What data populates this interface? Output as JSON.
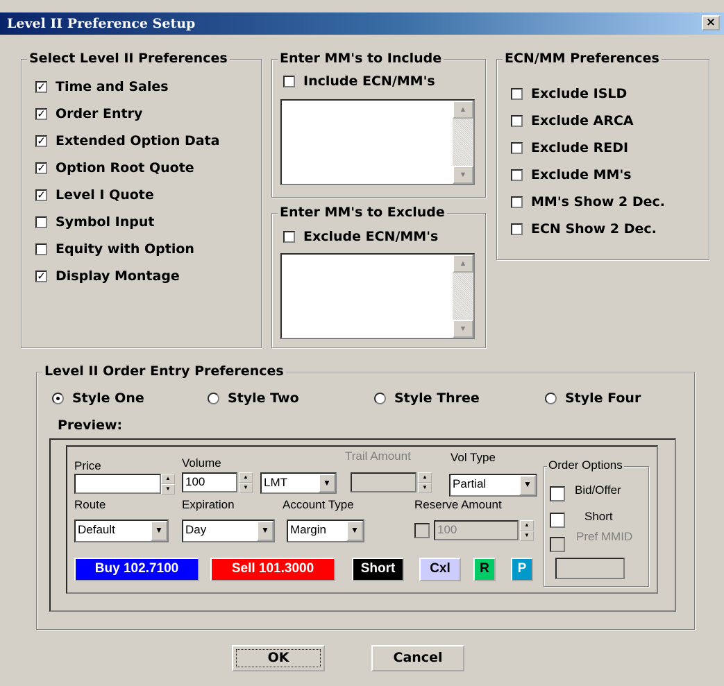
{
  "window": {
    "title": "Level II Preference Setup",
    "close_glyph": "×"
  },
  "select_prefs": {
    "title": "Select Level II Preferences",
    "items": [
      {
        "label": "Time and Sales",
        "checked": true
      },
      {
        "label": "Order Entry",
        "checked": true
      },
      {
        "label": "Extended Option Data",
        "checked": true
      },
      {
        "label": "Option Root Quote",
        "checked": true
      },
      {
        "label": "Level I Quote",
        "checked": true
      },
      {
        "label": "Symbol Input",
        "checked": false
      },
      {
        "label": "Equity with Option",
        "checked": false
      },
      {
        "label": "Display Montage",
        "checked": true
      }
    ]
  },
  "include_mm": {
    "title": "Enter MM's to Include",
    "checkbox_label": "Include ECN/MM's",
    "checked": false
  },
  "exclude_mm": {
    "title": "Enter MM's to Exclude",
    "checkbox_label": "Exclude ECN/MM's",
    "checked": false
  },
  "ecn_prefs": {
    "title": "ECN/MM Preferences",
    "items": [
      {
        "label": "Exclude ISLD",
        "checked": false
      },
      {
        "label": "Exclude ARCA",
        "checked": false
      },
      {
        "label": "Exclude REDI",
        "checked": false
      },
      {
        "label": "Exclude MM's",
        "checked": false
      },
      {
        "label": "MM's Show 2 Dec.",
        "checked": false
      },
      {
        "label": "ECN Show 2 Dec.",
        "checked": false
      }
    ]
  },
  "order_entry": {
    "title": "Level II Order Entry Preferences",
    "styles": [
      {
        "label": "Style One",
        "selected": true
      },
      {
        "label": "Style Two",
        "selected": false
      },
      {
        "label": "Style Three",
        "selected": false
      },
      {
        "label": "Style Four",
        "selected": false
      }
    ],
    "preview_label": "Preview:"
  },
  "preview": {
    "price_label": "Price",
    "price_value": "",
    "volume_label": "Volume",
    "volume_value": "100",
    "order_type": "LMT",
    "trail_label": "Trail Amount",
    "trail_value": "",
    "vol_type_label": "Vol Type",
    "vol_type_value": "Partial",
    "route_label": "Route",
    "route_value": "Default",
    "expiration_label": "Expiration",
    "expiration_value": "Day",
    "account_label": "Account Type",
    "account_value": "Margin",
    "reserve_label": "Reserve Amount",
    "reserve_value": "100",
    "order_options": {
      "title": "Order Options",
      "bid_offer": "Bid/Offer",
      "short": "Short",
      "pref_mmid": "Pref MMID"
    },
    "buttons": {
      "buy": "Buy 102.7100",
      "sell": "Sell 101.3000",
      "short": "Short",
      "cxl": "Cxl",
      "r": "R",
      "p": "P"
    },
    "colors": {
      "buy": "#0000ff",
      "sell": "#ff0000",
      "short": "#000000",
      "cxl": "#ccccff",
      "r": "#00cc66",
      "p": "#0099cc"
    }
  },
  "footer": {
    "ok_label": "OK",
    "cancel_label": "Cancel"
  }
}
